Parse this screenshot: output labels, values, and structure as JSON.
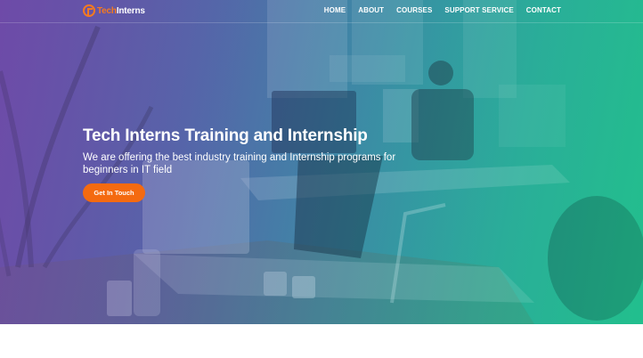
{
  "brand": {
    "logo_prefix": "Tech",
    "logo_suffix": "Interns",
    "accent_color": "#f47a20"
  },
  "nav": {
    "items": [
      "HOME",
      "ABOUT",
      "COURSES",
      "SUPPORT SERVICE",
      "CONTACT"
    ]
  },
  "hero": {
    "title": "Tech Interns Training and Internship",
    "subtitle": "We are offering the best industry training and Internship programs for beginners in IT field",
    "cta_label": "Get In Touch",
    "cta_color": "#f46a10"
  }
}
